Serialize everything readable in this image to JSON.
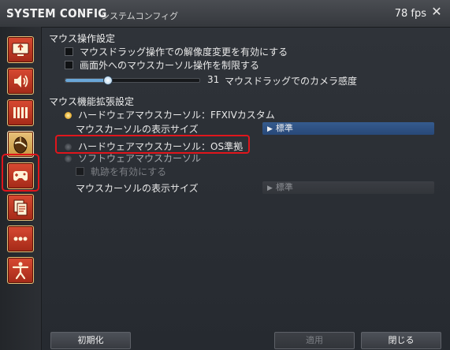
{
  "window": {
    "title": "SYSTEM CONFIG",
    "subtitle": "システムコンフィグ",
    "fps": "78 fps",
    "close_glyph": "✕"
  },
  "sidebar": {
    "categories": [
      {
        "icon": "monitor-icon",
        "active": false
      },
      {
        "icon": "speaker-icon",
        "active": false
      },
      {
        "icon": "bars-icon",
        "active": false
      },
      {
        "icon": "mouse-icon",
        "active": true
      },
      {
        "icon": "gamepad-icon",
        "active": false
      },
      {
        "icon": "documents-icon",
        "active": false
      },
      {
        "icon": "more-icon",
        "active": false
      },
      {
        "icon": "accessibility-icon",
        "active": false
      }
    ]
  },
  "mouse_operation": {
    "heading": "マウス操作設定",
    "opt_resolution": "マウスドラッグ操作での解像度変更を有効にする",
    "opt_restrict": "画面外へのマウスカーソル操作を制限する",
    "slider_value": "31",
    "slider_label": "マウスドラッグでのカメラ感度",
    "slider_fraction": 0.31
  },
  "mouse_extension": {
    "heading": "マウス機能拡張設定",
    "hw_custom": "ハードウェアマウスカーソル：FFXIVカスタム",
    "cursor_size_label": "マウスカーソルの表示サイズ",
    "cursor_size_value": "標準",
    "hw_os": "ハードウェアマウスカーソル：OS準拠",
    "sw_cursor": "ソフトウェアマウスカーソル",
    "trail": "軌跡を有効にする",
    "cursor_size_label_2": "マウスカーソルの表示サイズ",
    "cursor_size_value_2": "標準"
  },
  "buttons": {
    "reset": "初期化",
    "apply": "適用",
    "close": "閉じる"
  },
  "colors": {
    "accent_red": "#e0161c",
    "dropdown_blue": "#355b8e"
  }
}
